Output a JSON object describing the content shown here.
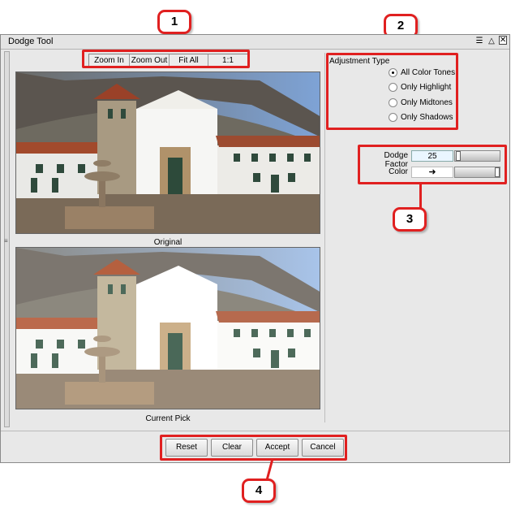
{
  "window": {
    "title": "Dodge Tool"
  },
  "title_icons": [
    "menu-icon",
    "restore-icon",
    "close-icon"
  ],
  "zoom_toolbar": {
    "zoom_in": "Zoom In",
    "zoom_out": "Zoom Out",
    "fit_all": "Fit All",
    "one_to_one": "1:1"
  },
  "images": {
    "original_caption": "Original",
    "current_caption": "Current Pick"
  },
  "adjustment": {
    "title": "Adjustment Type",
    "options": [
      {
        "label": "All Color Tones",
        "selected": true
      },
      {
        "label": "Only Highlight",
        "selected": false
      },
      {
        "label": "Only Midtones",
        "selected": false
      },
      {
        "label": "Only Shadows",
        "selected": false
      }
    ]
  },
  "params": {
    "dodge_factor_label": "Dodge Factor",
    "dodge_factor_value": "25",
    "dodge_factor_level": 0.25,
    "color_label": "Color",
    "color_glyph": "➜",
    "color_level": 1.0
  },
  "actions": {
    "reset": "Reset",
    "clear": "Clear",
    "accept": "Accept",
    "cancel": "Cancel"
  },
  "callouts": [
    "1",
    "2",
    "3",
    "4"
  ],
  "colors": {
    "highlight": "#e02020",
    "field_bg": "#eaf6ff"
  }
}
